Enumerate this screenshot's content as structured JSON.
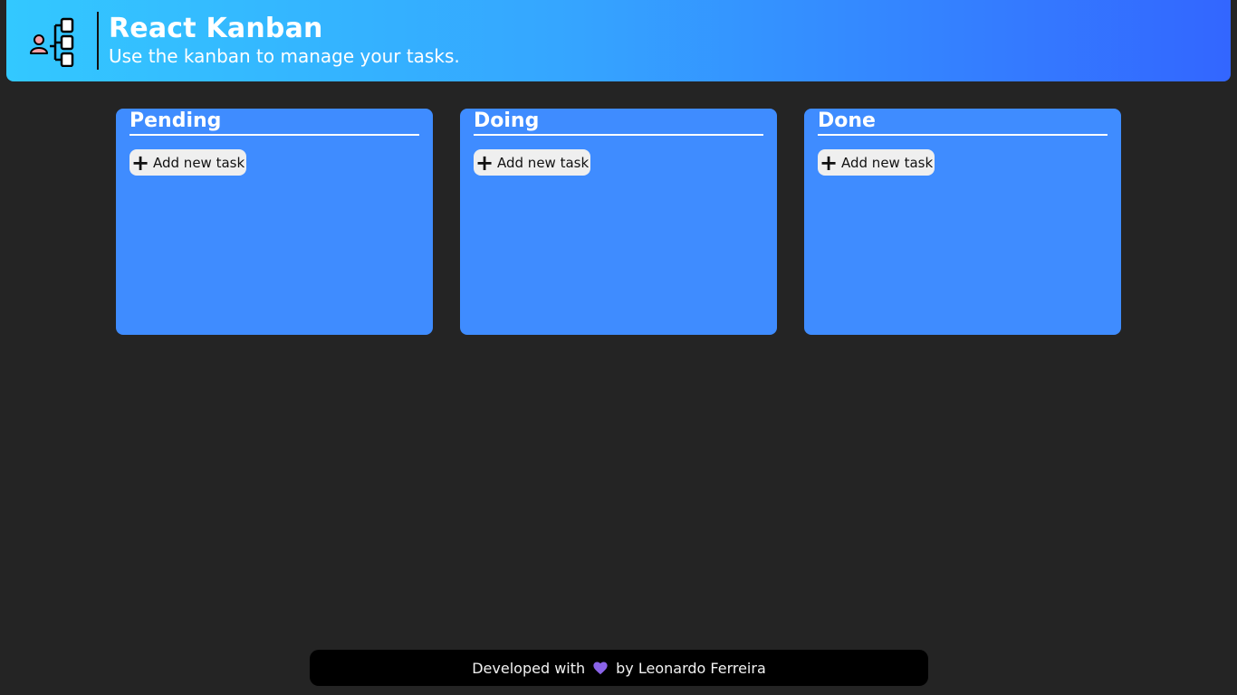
{
  "header": {
    "title": "React Kanban",
    "subtitle": "Use the kanban to manage your tasks.",
    "logo_icon": "kanban-person-icon",
    "gradient_start": "#33c8ff",
    "gradient_end": "#3366ff"
  },
  "columns": [
    {
      "title": "Pending",
      "add_label": "Add new task"
    },
    {
      "title": "Doing",
      "add_label": "Add new task"
    },
    {
      "title": "Done",
      "add_label": "Add new task"
    }
  ],
  "column_color": "#3f8cff",
  "footer": {
    "prefix": "Developed with",
    "heart_icon": "heart-icon",
    "heart_color": "#8a63e8",
    "suffix": "by Leonardo Ferreira"
  }
}
